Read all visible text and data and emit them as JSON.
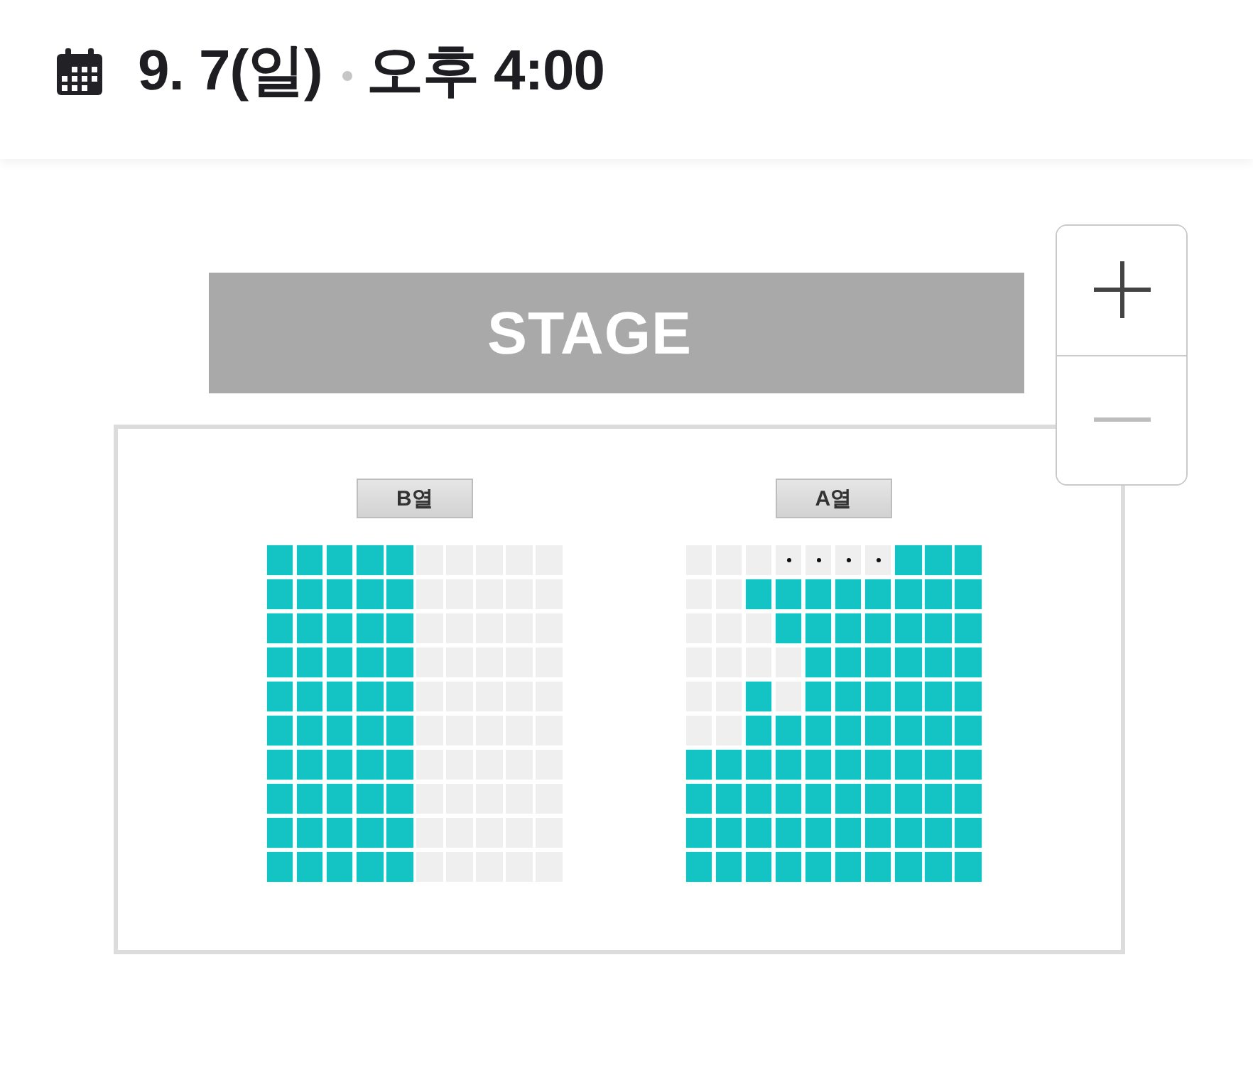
{
  "header": {
    "date": "9. 7(일)",
    "time": "오후 4:00"
  },
  "stage": {
    "label": "STAGE"
  },
  "zoom_controls": [
    {
      "kind": "plus",
      "disabled": false
    },
    {
      "kind": "minus",
      "disabled": true
    }
  ],
  "blocks": [
    {
      "label": "B열",
      "rows": [
        {
          "seats": [
            {
              "available": true,
              "dot": false
            },
            {
              "available": true,
              "dot": false
            },
            {
              "available": true,
              "dot": false
            },
            {
              "available": true,
              "dot": false
            },
            {
              "available": true,
              "dot": false
            },
            {
              "available": false,
              "dot": false
            },
            {
              "available": false,
              "dot": false
            },
            {
              "available": false,
              "dot": false
            },
            {
              "available": false,
              "dot": false
            },
            {
              "available": false,
              "dot": false
            }
          ]
        },
        {
          "seats": [
            {
              "available": true,
              "dot": false
            },
            {
              "available": true,
              "dot": false
            },
            {
              "available": true,
              "dot": false
            },
            {
              "available": true,
              "dot": false
            },
            {
              "available": true,
              "dot": false
            },
            {
              "available": false,
              "dot": false
            },
            {
              "available": false,
              "dot": false
            },
            {
              "available": false,
              "dot": false
            },
            {
              "available": false,
              "dot": false
            },
            {
              "available": false,
              "dot": false
            }
          ]
        },
        {
          "seats": [
            {
              "available": true,
              "dot": false
            },
            {
              "available": true,
              "dot": false
            },
            {
              "available": true,
              "dot": false
            },
            {
              "available": true,
              "dot": false
            },
            {
              "available": true,
              "dot": false
            },
            {
              "available": false,
              "dot": false
            },
            {
              "available": false,
              "dot": false
            },
            {
              "available": false,
              "dot": false
            },
            {
              "available": false,
              "dot": false
            },
            {
              "available": false,
              "dot": false
            }
          ]
        },
        {
          "seats": [
            {
              "available": true,
              "dot": false
            },
            {
              "available": true,
              "dot": false
            },
            {
              "available": true,
              "dot": false
            },
            {
              "available": true,
              "dot": false
            },
            {
              "available": true,
              "dot": false
            },
            {
              "available": false,
              "dot": false
            },
            {
              "available": false,
              "dot": false
            },
            {
              "available": false,
              "dot": false
            },
            {
              "available": false,
              "dot": false
            },
            {
              "available": false,
              "dot": false
            }
          ]
        },
        {
          "seats": [
            {
              "available": true,
              "dot": false
            },
            {
              "available": true,
              "dot": false
            },
            {
              "available": true,
              "dot": false
            },
            {
              "available": true,
              "dot": false
            },
            {
              "available": true,
              "dot": false
            },
            {
              "available": false,
              "dot": false
            },
            {
              "available": false,
              "dot": false
            },
            {
              "available": false,
              "dot": false
            },
            {
              "available": false,
              "dot": false
            },
            {
              "available": false,
              "dot": false
            }
          ]
        },
        {
          "seats": [
            {
              "available": true,
              "dot": false
            },
            {
              "available": true,
              "dot": false
            },
            {
              "available": true,
              "dot": false
            },
            {
              "available": true,
              "dot": false
            },
            {
              "available": true,
              "dot": false
            },
            {
              "available": false,
              "dot": false
            },
            {
              "available": false,
              "dot": false
            },
            {
              "available": false,
              "dot": false
            },
            {
              "available": false,
              "dot": false
            },
            {
              "available": false,
              "dot": false
            }
          ]
        },
        {
          "seats": [
            {
              "available": true,
              "dot": false
            },
            {
              "available": true,
              "dot": false
            },
            {
              "available": true,
              "dot": false
            },
            {
              "available": true,
              "dot": false
            },
            {
              "available": true,
              "dot": false
            },
            {
              "available": false,
              "dot": false
            },
            {
              "available": false,
              "dot": false
            },
            {
              "available": false,
              "dot": false
            },
            {
              "available": false,
              "dot": false
            },
            {
              "available": false,
              "dot": false
            }
          ]
        },
        {
          "seats": [
            {
              "available": true,
              "dot": false
            },
            {
              "available": true,
              "dot": false
            },
            {
              "available": true,
              "dot": false
            },
            {
              "available": true,
              "dot": false
            },
            {
              "available": true,
              "dot": false
            },
            {
              "available": false,
              "dot": false
            },
            {
              "available": false,
              "dot": false
            },
            {
              "available": false,
              "dot": false
            },
            {
              "available": false,
              "dot": false
            },
            {
              "available": false,
              "dot": false
            }
          ]
        },
        {
          "seats": [
            {
              "available": true,
              "dot": false
            },
            {
              "available": true,
              "dot": false
            },
            {
              "available": true,
              "dot": false
            },
            {
              "available": true,
              "dot": false
            },
            {
              "available": true,
              "dot": false
            },
            {
              "available": false,
              "dot": false
            },
            {
              "available": false,
              "dot": false
            },
            {
              "available": false,
              "dot": false
            },
            {
              "available": false,
              "dot": false
            },
            {
              "available": false,
              "dot": false
            }
          ]
        },
        {
          "seats": [
            {
              "available": true,
              "dot": false
            },
            {
              "available": true,
              "dot": false
            },
            {
              "available": true,
              "dot": false
            },
            {
              "available": true,
              "dot": false
            },
            {
              "available": true,
              "dot": false
            },
            {
              "available": false,
              "dot": false
            },
            {
              "available": false,
              "dot": false
            },
            {
              "available": false,
              "dot": false
            },
            {
              "available": false,
              "dot": false
            },
            {
              "available": false,
              "dot": false
            }
          ]
        }
      ]
    },
    {
      "label": "A열",
      "rows": [
        {
          "seats": [
            {
              "available": false,
              "dot": false
            },
            {
              "available": false,
              "dot": false
            },
            {
              "available": false,
              "dot": false
            },
            {
              "available": false,
              "dot": true
            },
            {
              "available": false,
              "dot": true
            },
            {
              "available": false,
              "dot": true
            },
            {
              "available": false,
              "dot": true
            },
            {
              "available": true,
              "dot": false
            },
            {
              "available": true,
              "dot": false
            },
            {
              "available": true,
              "dot": false
            }
          ]
        },
        {
          "seats": [
            {
              "available": false,
              "dot": false
            },
            {
              "available": false,
              "dot": false
            },
            {
              "available": true,
              "dot": false
            },
            {
              "available": true,
              "dot": false
            },
            {
              "available": true,
              "dot": false
            },
            {
              "available": true,
              "dot": false
            },
            {
              "available": true,
              "dot": false
            },
            {
              "available": true,
              "dot": false
            },
            {
              "available": true,
              "dot": false
            },
            {
              "available": true,
              "dot": false
            }
          ]
        },
        {
          "seats": [
            {
              "available": false,
              "dot": false
            },
            {
              "available": false,
              "dot": false
            },
            {
              "available": false,
              "dot": false
            },
            {
              "available": true,
              "dot": false
            },
            {
              "available": true,
              "dot": false
            },
            {
              "available": true,
              "dot": false
            },
            {
              "available": true,
              "dot": false
            },
            {
              "available": true,
              "dot": false
            },
            {
              "available": true,
              "dot": false
            },
            {
              "available": true,
              "dot": false
            }
          ]
        },
        {
          "seats": [
            {
              "available": false,
              "dot": false
            },
            {
              "available": false,
              "dot": false
            },
            {
              "available": false,
              "dot": false
            },
            {
              "available": false,
              "dot": false
            },
            {
              "available": true,
              "dot": false
            },
            {
              "available": true,
              "dot": false
            },
            {
              "available": true,
              "dot": false
            },
            {
              "available": true,
              "dot": false
            },
            {
              "available": true,
              "dot": false
            },
            {
              "available": true,
              "dot": false
            }
          ]
        },
        {
          "seats": [
            {
              "available": false,
              "dot": false
            },
            {
              "available": false,
              "dot": false
            },
            {
              "available": true,
              "dot": false
            },
            {
              "available": false,
              "dot": false
            },
            {
              "available": true,
              "dot": false
            },
            {
              "available": true,
              "dot": false
            },
            {
              "available": true,
              "dot": false
            },
            {
              "available": true,
              "dot": false
            },
            {
              "available": true,
              "dot": false
            },
            {
              "available": true,
              "dot": false
            }
          ]
        },
        {
          "seats": [
            {
              "available": false,
              "dot": false
            },
            {
              "available": false,
              "dot": false
            },
            {
              "available": true,
              "dot": false
            },
            {
              "available": true,
              "dot": false
            },
            {
              "available": true,
              "dot": false
            },
            {
              "available": true,
              "dot": false
            },
            {
              "available": true,
              "dot": false
            },
            {
              "available": true,
              "dot": false
            },
            {
              "available": true,
              "dot": false
            },
            {
              "available": true,
              "dot": false
            }
          ]
        },
        {
          "seats": [
            {
              "available": true,
              "dot": false
            },
            {
              "available": true,
              "dot": false
            },
            {
              "available": true,
              "dot": false
            },
            {
              "available": true,
              "dot": false
            },
            {
              "available": true,
              "dot": false
            },
            {
              "available": true,
              "dot": false
            },
            {
              "available": true,
              "dot": false
            },
            {
              "available": true,
              "dot": false
            },
            {
              "available": true,
              "dot": false
            },
            {
              "available": true,
              "dot": false
            }
          ]
        },
        {
          "seats": [
            {
              "available": true,
              "dot": false
            },
            {
              "available": true,
              "dot": false
            },
            {
              "available": true,
              "dot": false
            },
            {
              "available": true,
              "dot": false
            },
            {
              "available": true,
              "dot": false
            },
            {
              "available": true,
              "dot": false
            },
            {
              "available": true,
              "dot": false
            },
            {
              "available": true,
              "dot": false
            },
            {
              "available": true,
              "dot": false
            },
            {
              "available": true,
              "dot": false
            }
          ]
        },
        {
          "seats": [
            {
              "available": true,
              "dot": false
            },
            {
              "available": true,
              "dot": false
            },
            {
              "available": true,
              "dot": false
            },
            {
              "available": true,
              "dot": false
            },
            {
              "available": true,
              "dot": false
            },
            {
              "available": true,
              "dot": false
            },
            {
              "available": true,
              "dot": false
            },
            {
              "available": true,
              "dot": false
            },
            {
              "available": true,
              "dot": false
            },
            {
              "available": true,
              "dot": false
            }
          ]
        },
        {
          "seats": [
            {
              "available": true,
              "dot": false
            },
            {
              "available": true,
              "dot": false
            },
            {
              "available": true,
              "dot": false
            },
            {
              "available": true,
              "dot": false
            },
            {
              "available": true,
              "dot": false
            },
            {
              "available": true,
              "dot": false
            },
            {
              "available": true,
              "dot": false
            },
            {
              "available": true,
              "dot": false
            },
            {
              "available": true,
              "dot": false
            },
            {
              "available": true,
              "dot": false
            }
          ]
        }
      ]
    }
  ]
}
